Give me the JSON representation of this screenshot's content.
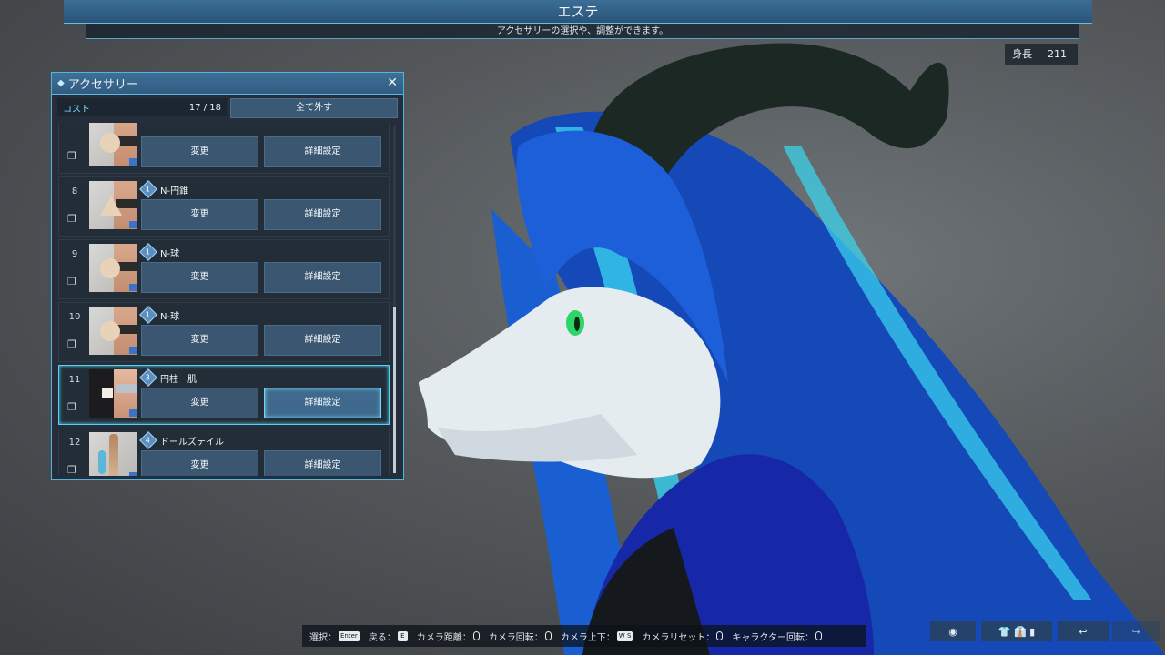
{
  "header": {
    "title": "エステ",
    "subtitle": "アクセサリーの選択や、調整ができます。"
  },
  "height_readout": {
    "label": "身長",
    "value": "211"
  },
  "panel": {
    "title": "アクセサリー",
    "cost_label": "コスト",
    "cost_value": "17 / 18",
    "remove_all": "全て外す",
    "items": [
      {
        "number": "",
        "level": "",
        "name": "",
        "change": "変更",
        "detail": "詳細設定",
        "thumb": "sphere"
      },
      {
        "number": "8",
        "level": "1",
        "name": "N-円錐",
        "change": "変更",
        "detail": "詳細設定",
        "thumb": "cone"
      },
      {
        "number": "9",
        "level": "1",
        "name": "N-球",
        "change": "変更",
        "detail": "詳細設定",
        "thumb": "sphere"
      },
      {
        "number": "10",
        "level": "1",
        "name": "N-球",
        "change": "変更",
        "detail": "詳細設定",
        "thumb": "sphere"
      },
      {
        "number": "11",
        "level": "3",
        "name": "円柱　肌",
        "change": "変更",
        "detail": "詳細設定",
        "thumb": "cylinder"
      },
      {
        "number": "12",
        "level": "4",
        "name": "ドールズテイル",
        "change": "変更",
        "detail": "詳細設定",
        "thumb": "doll"
      }
    ]
  },
  "bottom_hints": [
    {
      "label": "選択：",
      "key": "Enter"
    },
    {
      "label": "戻る：",
      "key": "E"
    },
    {
      "label": "カメラ距離：",
      "key": "mouse"
    },
    {
      "label": "カメラ回転：",
      "key": "mouse"
    },
    {
      "label": "カメラ上下：",
      "key": "W S"
    },
    {
      "label": "カメラリセット：",
      "key": "mouse"
    },
    {
      "label": "キャラクター回転：",
      "key": "mouse"
    }
  ],
  "bottom_right_buttons": [
    {
      "icon": "sphere-icon",
      "glyph": "◉"
    },
    {
      "icon": "outfit-icon",
      "glyph": "👕 👔 ▮"
    },
    {
      "icon": "undo-icon",
      "glyph": "↩"
    },
    {
      "icon": "redo-icon",
      "glyph": "↪"
    }
  ],
  "colors": {
    "accent": "#4fb6e4",
    "hair": "#1e63d6",
    "hair_highlight": "#35d4f0",
    "horn": "#1d2a26",
    "skin": "#e6eef2",
    "eye": "#3ce06a"
  }
}
